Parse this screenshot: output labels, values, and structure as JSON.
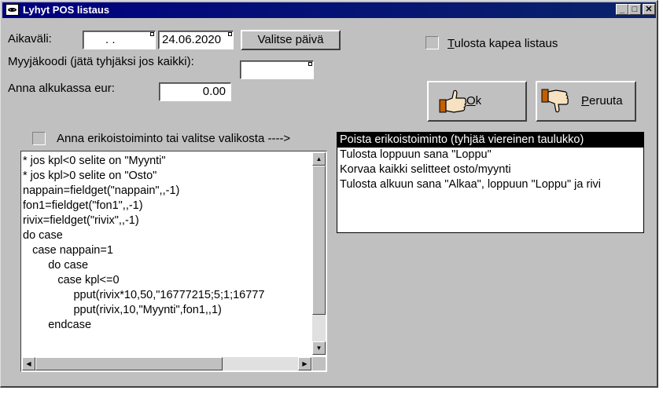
{
  "window": {
    "title": "Lyhyt POS listaus",
    "minimize": "_",
    "maximize": "□",
    "close": "✕"
  },
  "date_range": {
    "label": "Aikaväli:",
    "start": " .  .",
    "end": "24.06.2020",
    "select_button": "Valitse päivä"
  },
  "narrow_print": {
    "label": "Tulosta kapea listaus",
    "underline_char": "T",
    "label_rest": "ulosta kapea listaus"
  },
  "seller": {
    "label": "Myyjäkoodi (jätä tyhjäksi jos kaikki):",
    "value": ""
  },
  "opening_cash": {
    "label": "Anna alkukassa eur:",
    "value": "0.00"
  },
  "ok_button": {
    "label": "Ok",
    "underline_char": "O",
    "label_rest": "k",
    "icon": "thumbs-up-icon"
  },
  "cancel_button": {
    "label": "Peruuta",
    "underline_char": "P",
    "label_rest": "eruuta",
    "icon": "thumbs-down-icon"
  },
  "special_function": {
    "label": "Anna erikoistoiminto tai valitse valikosta ---->"
  },
  "code_lines": [
    "* jos kpl<0 selite on \"Myynti\"",
    "* jos kpl>0 selite on \"Osto\"",
    "nappain=fieldget(\"nappain\",,-1)",
    "fon1=fieldget(\"fon1\",,-1)",
    "rivix=fieldget(\"rivix\",,-1)",
    "do case",
    "   case nappain=1",
    "        do case",
    "           case kpl<=0",
    "                pput(rivix*10,50,\"16777215;5;1;16777",
    "                pput(rivix,10,\"Myynti\",fon1,,1)",
    "        endcase"
  ],
  "function_list": [
    "Poista erikoistoiminto (tyhjää viereinen taulukko)",
    "Tulosta loppuun sana \"Loppu\"",
    "Korvaa kaikki selitteet osto/myynti",
    "Tulosta alkuun sana \"Alkaa\", loppuun \"Loppu\" ja rivi"
  ],
  "function_list_selected": 0,
  "colors": {
    "face": "#c0c0c0",
    "title_bar": "#000080",
    "selection": "#000000"
  }
}
